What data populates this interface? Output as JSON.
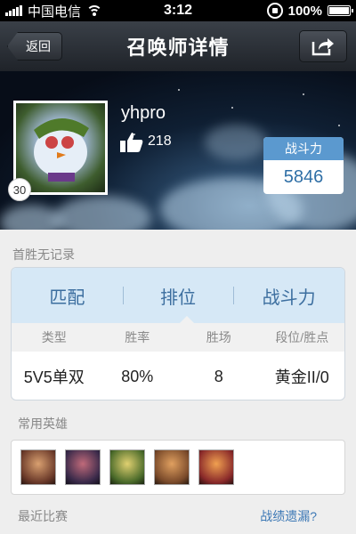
{
  "status_bar": {
    "carrier": "中国电信",
    "time": "3:12",
    "battery": "100%",
    "battery_level": 1.0
  },
  "navbar": {
    "back_label": "返回",
    "title": "召唤师详情",
    "share_icon": "share-icon"
  },
  "profile": {
    "username": "yhpro",
    "likes": "218",
    "level": "30",
    "power_label": "战斗力",
    "power_value": "5846"
  },
  "first_win": "首胜无记录",
  "stats": {
    "tabs": [
      {
        "label": "匹配"
      },
      {
        "label": "排位"
      },
      {
        "label": "战斗力"
      }
    ],
    "selected_tab": "排位",
    "headers": [
      "类型",
      "胜率",
      "胜场",
      "段位/胜点"
    ],
    "row": [
      "5V5单双",
      "80%",
      "8",
      "黄金II/0"
    ]
  },
  "frequent_heroes": {
    "label": "常用英雄",
    "icons": [
      {
        "name": "hero-1-icon",
        "color": "#6b3a2a"
      },
      {
        "name": "hero-2-icon",
        "color": "#3a2a4a"
      },
      {
        "name": "hero-3-icon",
        "color": "#4a6a2a"
      },
      {
        "name": "hero-4-icon",
        "color": "#7a4a2a"
      },
      {
        "name": "hero-5-icon",
        "color": "#8a2a2a"
      }
    ]
  },
  "recent_matches": {
    "label": "最近比赛",
    "link": "战绩遗漏?"
  }
}
